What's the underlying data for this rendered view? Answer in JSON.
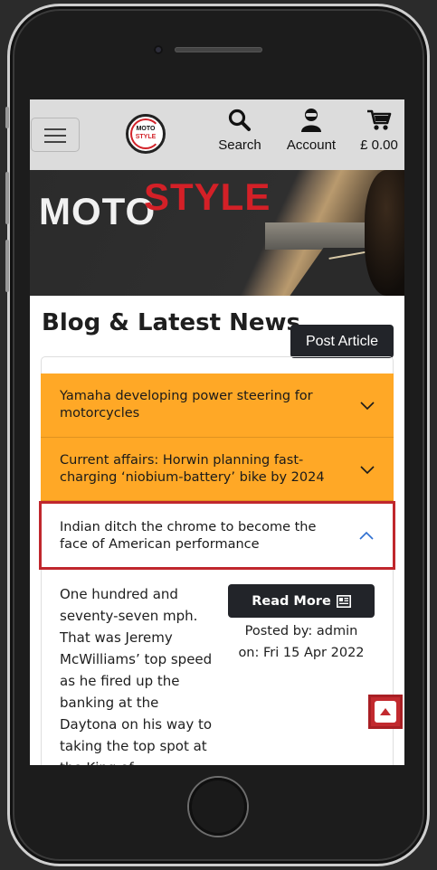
{
  "header": {
    "menu_icon": "hamburger-icon",
    "logo": {
      "line1": "MOTO",
      "line2": "STYLE"
    },
    "nav": [
      {
        "icon": "search-icon",
        "label": "Search"
      },
      {
        "icon": "account-icon",
        "label": "Account"
      },
      {
        "icon": "cart-icon",
        "label": "£ 0.00"
      }
    ]
  },
  "banner": {
    "word1": "MOTO",
    "word2": "STYLE"
  },
  "page": {
    "title": "Blog & Latest News",
    "post_article_label": "Post Article"
  },
  "articles": [
    {
      "title": "Yamaha developing power steering for motorcycles",
      "expanded": false
    },
    {
      "title": "Current affairs: Horwin planning fast-charging ‘niobium-battery’ bike by 2024",
      "expanded": false
    },
    {
      "title": "Indian ditch the chrome to become the face of American performance",
      "expanded": true
    }
  ],
  "open_article": {
    "excerpt": "One hundred and seventy-seven mph. That was Jeremy McWilliams’ top speed as he fired up the banking at the Daytona on his way to taking the top spot at the King of",
    "read_more_label": "Read More",
    "read_more_icon": "newspaper-icon",
    "posted_by": "Posted by: admin",
    "posted_on": "on: Fri 15 Apr 2022"
  },
  "back_to_top_icon": "arrow-up-icon",
  "colors": {
    "accent_orange": "#ffa826",
    "brand_red": "#d42027",
    "dark_button": "#222429",
    "highlight_border": "#c0272d"
  }
}
